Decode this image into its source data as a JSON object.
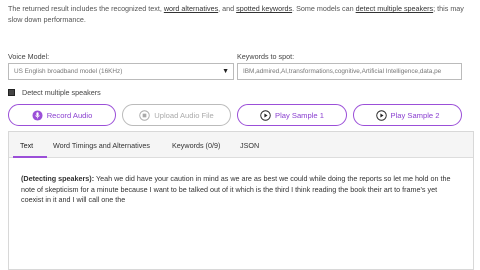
{
  "intro": {
    "part1": "The returned result includes the recognized text, ",
    "link1": "word alternatives",
    "part2": ", and ",
    "link2": "spotted keywords",
    "part3": ". Some models can ",
    "link3": "detect multiple speakers",
    "part4": "; this may slow down performance."
  },
  "voice_model": {
    "label": "Voice Model:",
    "value": "US English broadband model (16KHz)"
  },
  "keywords": {
    "label": "Keywords to spot:",
    "value": "IBM,admired,AI,transformations,cognitive,Artificial Intelligence,data,pe"
  },
  "detect_speakers": {
    "label": "Detect multiple speakers",
    "checked": true
  },
  "buttons": {
    "record": "Record Audio",
    "upload": "Upload Audio File",
    "sample1": "Play Sample 1",
    "sample2": "Play Sample 2"
  },
  "tabs": [
    "Text",
    "Word Timings and Alternatives",
    "Keywords (0/9)",
    "JSON"
  ],
  "active_tab": "Text",
  "transcript": {
    "speaker_label": "(Detecting speakers):",
    "text": " Yeah we did have your caution in mind as we are as best we could while doing the reports so let me hold on the note of skepticism for a minute because I want to be talked out of it which is the third I think reading the book their art to frame's yet coexist in it and I will call one the"
  },
  "colors": {
    "accent": "#9b4fd8",
    "disabled": "#bbbbbb"
  }
}
